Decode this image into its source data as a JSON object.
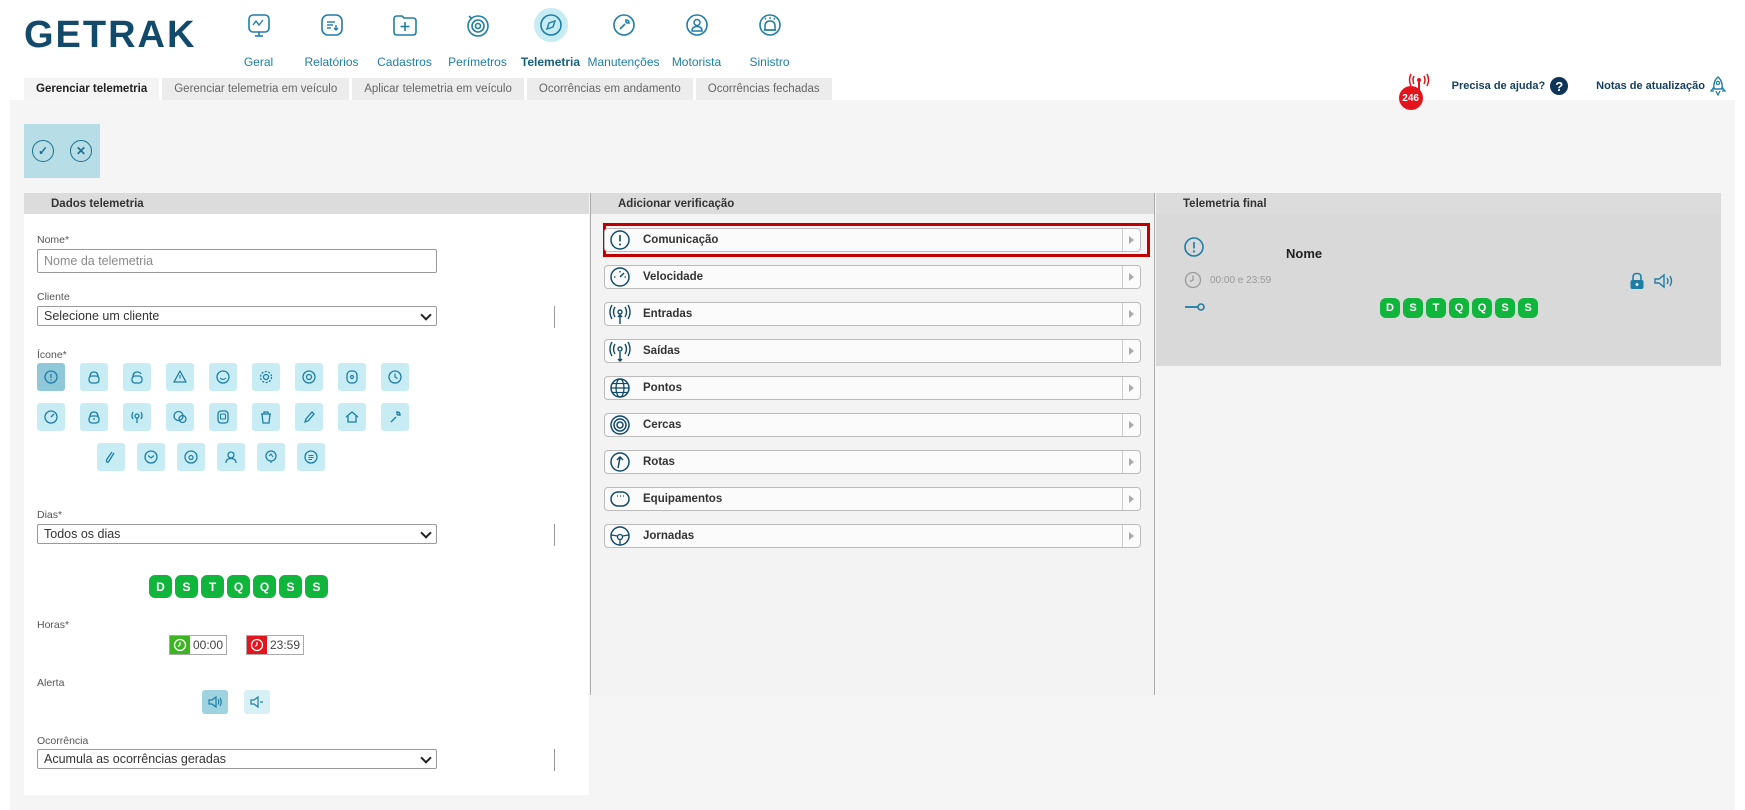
{
  "app": {
    "logo_text": "GETRAK"
  },
  "nav": [
    {
      "label": "Geral",
      "icon": "monitor-icon",
      "active": false
    },
    {
      "label": "Relatórios",
      "icon": "report-icon",
      "active": false
    },
    {
      "label": "Cadastros",
      "icon": "folder-plus-icon",
      "active": false
    },
    {
      "label": "Perímetros",
      "icon": "target-icon",
      "active": false
    },
    {
      "label": "Telemetria",
      "icon": "compass-icon",
      "active": true
    },
    {
      "label": "Manutenções",
      "icon": "wrench-icon",
      "active": false
    },
    {
      "label": "Motorista",
      "icon": "driver-icon",
      "active": false
    },
    {
      "label": "Sinistro",
      "icon": "alarm-icon",
      "active": false
    }
  ],
  "subtabs": [
    {
      "label": "Gerenciar telemetria",
      "active": true
    },
    {
      "label": "Gerenciar telemetria em veículo",
      "active": false
    },
    {
      "label": "Aplicar telemetria em veículo",
      "active": false
    },
    {
      "label": "Ocorrências em andamento",
      "active": false
    },
    {
      "label": "Ocorrências fechadas",
      "active": false
    }
  ],
  "help": {
    "notification_count": "246",
    "help_label": "Precisa de ajuda?",
    "help_glyph": "?",
    "notes_label": "Notas de atualização"
  },
  "actions": {
    "confirm_glyph": "✓",
    "cancel_glyph": "✕"
  },
  "dados": {
    "title": "Dados telemetria",
    "nome_label": "Nome*",
    "nome_placeholder": "Nome da telemetria",
    "cliente_label": "Cliente",
    "cliente_value": "Selecione um cliente",
    "icone_label": "Ícone*",
    "dias_label": "Dias*",
    "dias_value": "Todos os dias",
    "days": [
      "D",
      "S",
      "T",
      "Q",
      "Q",
      "S",
      "S"
    ],
    "horas_label": "Horas*",
    "hora_inicio": "00:00",
    "hora_fim": "23:59",
    "alerta_label": "Alerta",
    "ocorrencia_label": "Ocorrência",
    "ocorrencia_value": "Acumula as ocorrências geradas"
  },
  "verificacao": {
    "title": "Adicionar verificação",
    "items": [
      {
        "label": "Comunicação",
        "icon": "exclamation-icon"
      },
      {
        "label": "Velocidade",
        "icon": "speedometer-icon"
      },
      {
        "label": "Entradas",
        "icon": "signal-in-icon"
      },
      {
        "label": "Saídas",
        "icon": "signal-out-icon"
      },
      {
        "label": "Pontos",
        "icon": "globe-icon"
      },
      {
        "label": "Cercas",
        "icon": "target-icon"
      },
      {
        "label": "Rotas",
        "icon": "route-arrow-icon"
      },
      {
        "label": "Equipamentos",
        "icon": "device-icon"
      },
      {
        "label": "Jornadas",
        "icon": "steering-wheel-icon"
      }
    ]
  },
  "final": {
    "title": "Telemetria final",
    "name": "Nome",
    "time_range": "00:00 e 23:59",
    "days": [
      "D",
      "S",
      "T",
      "Q",
      "Q",
      "S",
      "S"
    ]
  },
  "colors": {
    "accent": "#1e7ea6",
    "day_green": "#10b53b",
    "highlight": "#c00000",
    "badge_red": "#e3141b"
  }
}
